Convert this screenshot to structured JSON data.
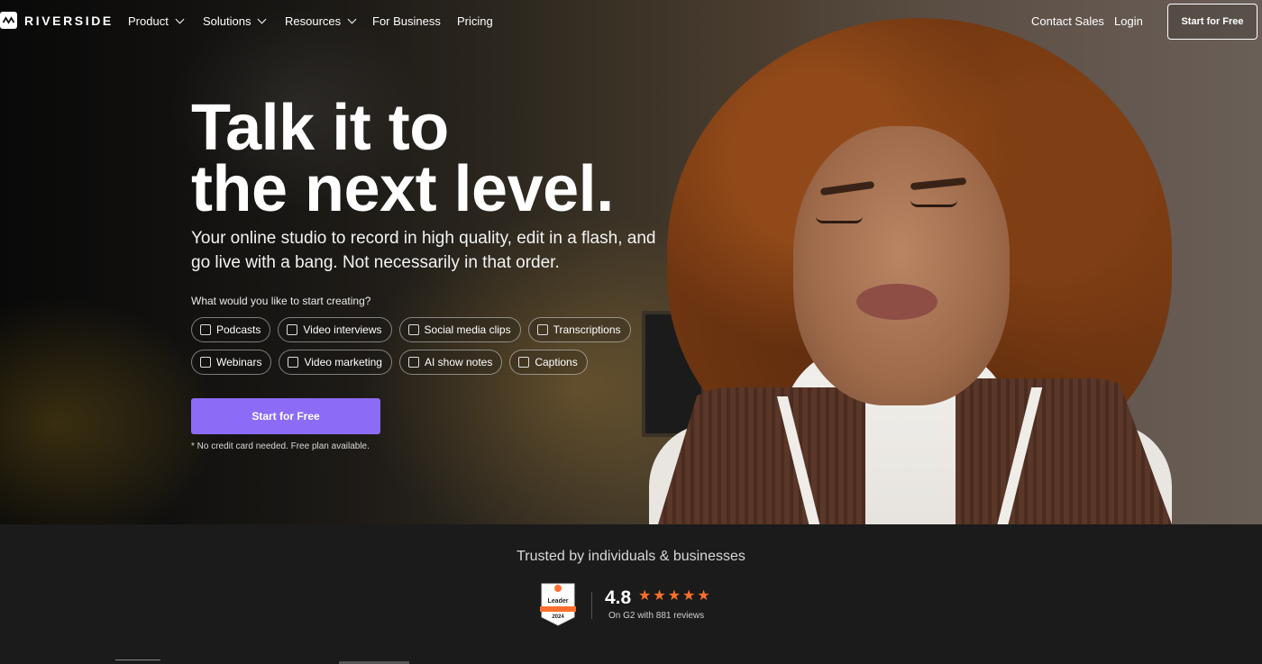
{
  "nav": {
    "brand": "RIVERSIDE",
    "items": [
      {
        "label": "Product"
      },
      {
        "label": "Solutions"
      },
      {
        "label": "Resources"
      },
      {
        "label": "For Business"
      },
      {
        "label": "Pricing"
      }
    ],
    "contact_sales": "Contact Sales",
    "login": "Login",
    "start_free": "Start for Free"
  },
  "hero": {
    "headline_line1": "Talk it to",
    "headline_line2": "the next level.",
    "subhead": "Your online studio to record in high quality, edit in a flash, and go live with a bang. Not necessarily in that order.",
    "prompt": "What would you like to start creating?",
    "chips_row1": [
      "Podcasts",
      "Video interviews",
      "Social media clips",
      "Transcriptions"
    ],
    "chips_row2": [
      "Webinars",
      "Video marketing",
      "AI show notes",
      "Captions"
    ],
    "cta": "Start for Free",
    "note": "* No credit card needed. Free plan available."
  },
  "trusted": {
    "title": "Trusted by individuals & businesses",
    "badge_label": "Leader",
    "badge_year": "2024",
    "rating": "4.8",
    "stars": 5,
    "reviews": "On G2 with 881 reviews"
  },
  "colors": {
    "accent": "#8c6cf6",
    "star": "#ff6f2c",
    "footer_bg": "#1b1b1b"
  }
}
